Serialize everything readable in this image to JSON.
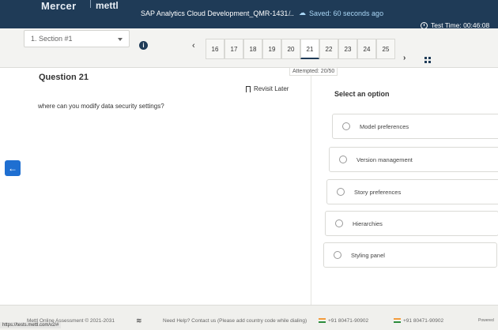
{
  "header": {
    "brand": "Mercer",
    "brand2": "mettl",
    "test_title": "SAP Analytics Cloud Development_QMR-1431...",
    "separator": "/",
    "saved": "Saved: 60 seconds ago",
    "timer_label": "Test Time: 00:46:08"
  },
  "nav": {
    "section": "1. Section #1",
    "attempted": "Attempted: 20/50",
    "questions": [
      "16",
      "17",
      "18",
      "19",
      "20",
      "21",
      "22",
      "23",
      "24",
      "25"
    ],
    "current": "21"
  },
  "question": {
    "title": "Question 21",
    "revisit": "Revisit Later",
    "text": "where can you modify data security settings?",
    "options_heading": "Select an option",
    "options": [
      "Model preferences",
      "Version management",
      "Story preferences",
      "Hierarchies",
      "Styling panel"
    ]
  },
  "footer": {
    "copyright": "Mettl Online Assessment © 2021-2031",
    "help": "Need Help? Contact us (Please add country code while dialing)",
    "phone1": "+91 80471-90902",
    "phone2": "+91 80471-90902",
    "powered": "Powered",
    "url": "https://tests.mettl.com/v2/#"
  }
}
